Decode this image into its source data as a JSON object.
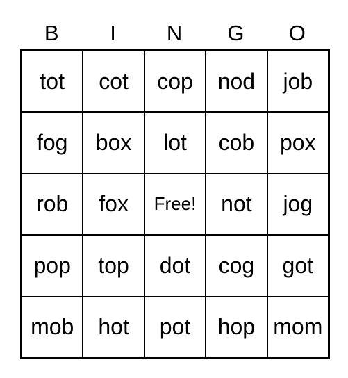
{
  "header": [
    "B",
    "I",
    "N",
    "G",
    "O"
  ],
  "rows": [
    [
      "tot",
      "cot",
      "cop",
      "nod",
      "job"
    ],
    [
      "fog",
      "box",
      "lot",
      "cob",
      "pox"
    ],
    [
      "rob",
      "fox",
      "Free!",
      "not",
      "jog"
    ],
    [
      "pop",
      "top",
      "dot",
      "cog",
      "got"
    ],
    [
      "mob",
      "hot",
      "pot",
      "hop",
      "mom"
    ]
  ]
}
